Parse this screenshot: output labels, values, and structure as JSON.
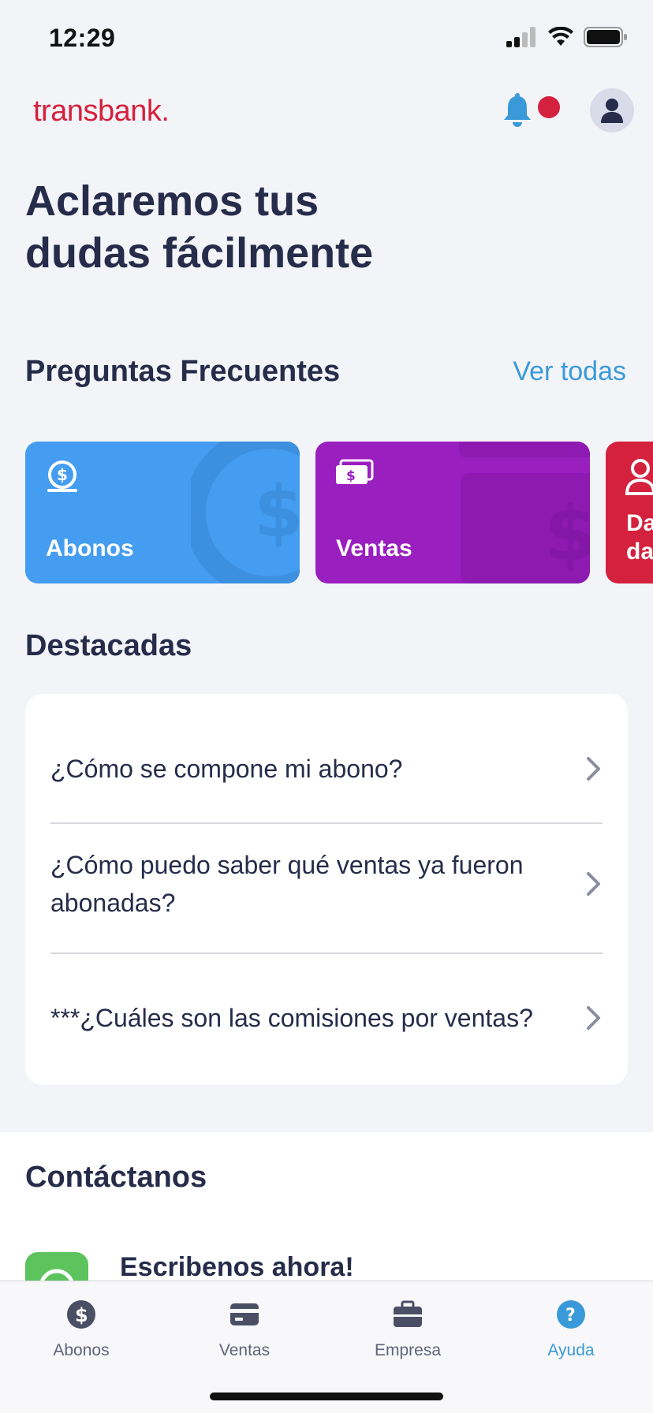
{
  "status_bar": {
    "time": "12:29"
  },
  "header": {
    "logo": "transbank.",
    "bell_color": "#3a9ad9",
    "notification_dot_color": "#d4213d"
  },
  "page_title": "Aclaremos tus\ndudas fácilmente",
  "faq": {
    "title": "Preguntas Frecuentes",
    "see_all": "Ver todas",
    "categories": [
      {
        "label": "Abonos",
        "color": "#449df0",
        "icon": "coin-icon"
      },
      {
        "label": "Ventas",
        "color": "#9a1fbf",
        "icon": "cash-icon"
      },
      {
        "label": "Da\nda",
        "color": "#d4213d",
        "icon": "user-icon"
      }
    ]
  },
  "featured": {
    "title": "Destacadas",
    "items": [
      {
        "question": "¿Cómo se compone mi abono?"
      },
      {
        "question": "¿Cómo puedo saber qué ventas ya fueron abonadas?"
      },
      {
        "question": "***¿Cuáles son las comisiones por ventas?"
      }
    ]
  },
  "contact": {
    "title": "Contáctanos",
    "action": "Escribenos ahora!"
  },
  "tabs": [
    {
      "label": "Abonos",
      "icon": "dollar-circle-icon",
      "active": false
    },
    {
      "label": "Ventas",
      "icon": "card-icon",
      "active": false
    },
    {
      "label": "Empresa",
      "icon": "briefcase-icon",
      "active": false
    },
    {
      "label": "Ayuda",
      "icon": "help-icon",
      "active": true
    }
  ]
}
